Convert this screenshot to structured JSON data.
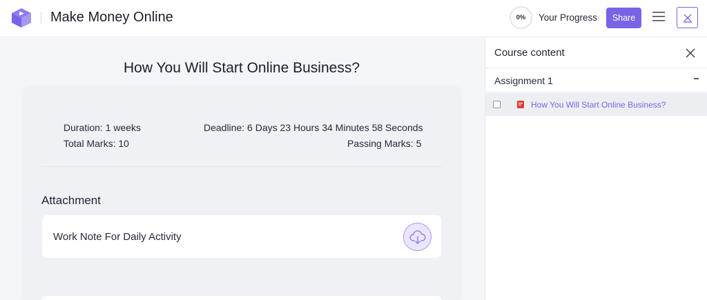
{
  "header": {
    "app_title": "Make Money Online",
    "progress_value": "0%",
    "progress_fraction": 0,
    "progress_label": "Your Progress",
    "share_label": "Share",
    "accent_color": "#7b63e6",
    "icons": {
      "logo": "graduation-cap-logo-icon",
      "menu": "hamburger-menu-icon",
      "close": "close-course-icon"
    }
  },
  "assignment": {
    "title": "How You Will Start Online Business?",
    "duration_label": "Duration:",
    "duration_value": "1 weeks",
    "deadline_label": "Deadline:",
    "deadline_value": "6 Days 23 Hours 34 Minutes 58 Seconds",
    "total_marks_label": "Total Marks:",
    "total_marks_value": "10",
    "passing_marks_label": "Passing Marks:",
    "passing_marks_value": "5"
  },
  "attachments": {
    "heading": "Attachment",
    "items": [
      {
        "name": "Work Note For Daily Activity",
        "icon": "cloud-download-icon"
      }
    ]
  },
  "sidebar": {
    "title": "Course content",
    "close_icon": "close-icon",
    "topics": [
      {
        "title": "Assignment 1",
        "toggle": "collapse-minus-icon",
        "lessons": [
          {
            "title": "How You Will Start Online Business?",
            "icon": "assignment-icon",
            "completed": false
          }
        ]
      }
    ]
  }
}
